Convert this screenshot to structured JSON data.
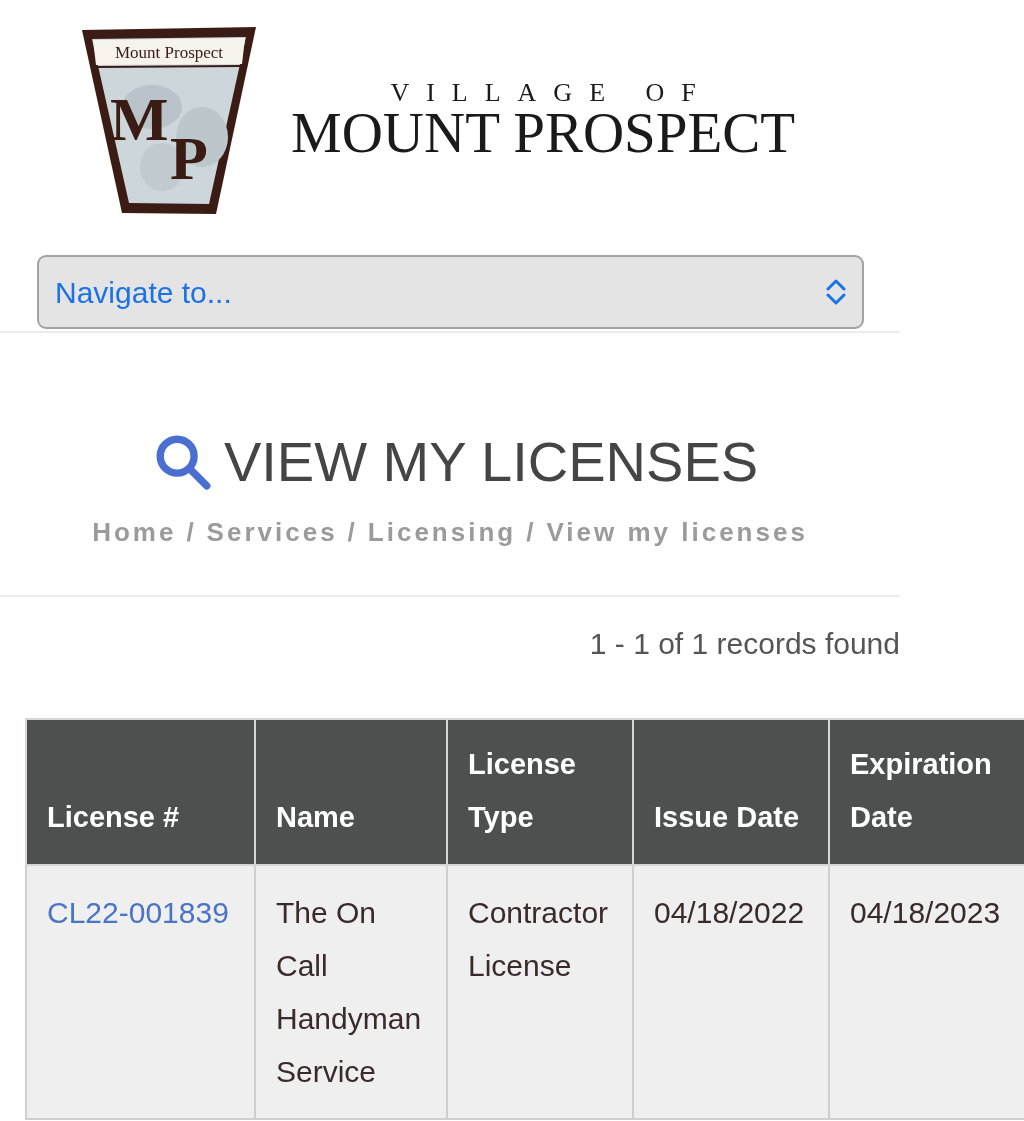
{
  "logo": {
    "badge_caption": "Mount Prospect",
    "monogram": [
      "M",
      "P"
    ],
    "subtitle": "VILLAGE OF",
    "title": "MOUNT PROSPECT"
  },
  "nav_select": {
    "value": "Navigate to..."
  },
  "page_title": "VIEW MY LICENSES",
  "breadcrumb": {
    "items": [
      "Home",
      "Services",
      "Licensing",
      "View my licenses"
    ],
    "separators": [
      "/",
      "/",
      "/"
    ]
  },
  "records_summary": "1 - 1 of 1 records found",
  "table": {
    "columns": [
      "License #",
      "Name",
      "License Type",
      "Issue Date",
      "Expiration Date"
    ],
    "rows": [
      {
        "cells": [
          {
            "kind": "link",
            "text": "CL22-001839"
          },
          {
            "kind": "text",
            "text": "The On Call Handyman Service"
          },
          {
            "kind": "text",
            "text": "Contractor License"
          },
          {
            "kind": "text",
            "text": "04/18/2022"
          },
          {
            "kind": "text",
            "text": "04/18/2023"
          }
        ]
      }
    ]
  }
}
